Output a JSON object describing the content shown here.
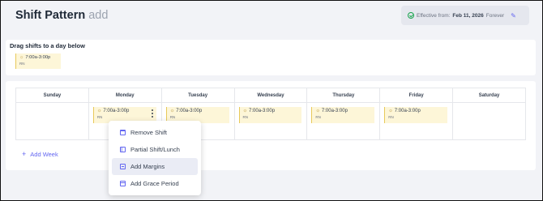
{
  "header": {
    "title": "Shift Pattern",
    "title_sub": "add",
    "effective_label": "Effective from:",
    "effective_date": "Feb 11, 2026",
    "effective_until": "Forever"
  },
  "drag": {
    "title": "Drag shifts to a day below",
    "shift": {
      "time": "7:00a-3:00p",
      "role": "RN"
    }
  },
  "week": {
    "days": [
      "Sunday",
      "Monday",
      "Tuesday",
      "Wednesday",
      "Thursday",
      "Friday",
      "Saturday"
    ],
    "shifts": {
      "monday": {
        "time": "7:00a-3:00p",
        "role": "RN"
      },
      "tuesday": {
        "time": "7:00a-3:00p",
        "role": "RN"
      },
      "wednesday": {
        "time": "7:00a-3:00p",
        "role": "RN"
      },
      "thursday": {
        "time": "7:00a-3:00p",
        "role": "RN"
      },
      "friday": {
        "time": "7:00a-3:00p",
        "role": "RN"
      }
    },
    "add_week_label": "Add Week"
  },
  "menu": {
    "items": [
      {
        "label": "Remove Shift",
        "icon": "trash-icon"
      },
      {
        "label": "Partial Shift/Lunch",
        "icon": "partial-shift-icon"
      },
      {
        "label": "Add Margins",
        "icon": "margins-icon",
        "active": true
      },
      {
        "label": "Add Grace Period",
        "icon": "calendar-icon"
      }
    ]
  },
  "colors": {
    "accent": "#6366f1",
    "shift_bg": "#fdf6d8",
    "shift_border": "#e8c95a",
    "page_bg": "#f2f3f7"
  }
}
